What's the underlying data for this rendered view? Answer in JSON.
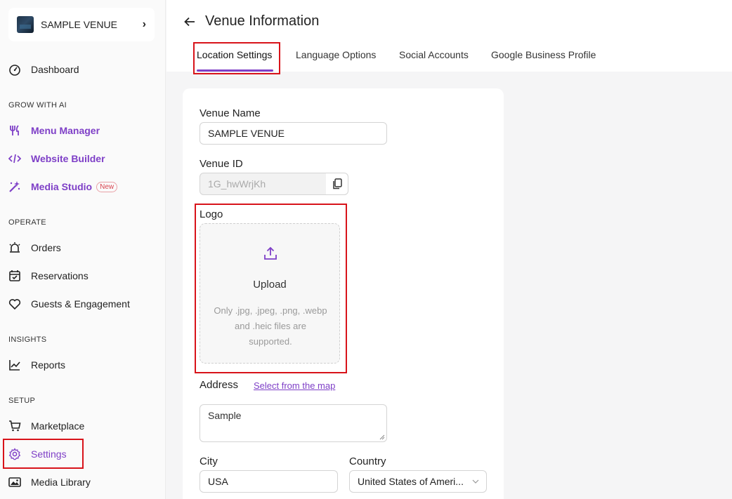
{
  "sidebar": {
    "venue_name": "SAMPLE VENUE",
    "dashboard": "Dashboard",
    "grow_section": "GROW WITH AI",
    "menu_manager": "Menu Manager",
    "website_builder": "Website Builder",
    "media_studio": "Media Studio",
    "new_badge": "New",
    "operate_section": "OPERATE",
    "orders": "Orders",
    "reservations": "Reservations",
    "guests": "Guests & Engagement",
    "insights_section": "INSIGHTS",
    "reports": "Reports",
    "setup_section": "SETUP",
    "marketplace": "Marketplace",
    "settings": "Settings",
    "media_library": "Media Library"
  },
  "header": {
    "title": "Venue Information",
    "tabs": [
      "Location Settings",
      "Language Options",
      "Social Accounts",
      "Google Business Profile"
    ]
  },
  "form": {
    "venue_name_label": "Venue Name",
    "venue_name_value": "SAMPLE VENUE",
    "venue_id_label": "Venue ID",
    "venue_id_value": "1G_hwWrjKh",
    "logo_label": "Logo",
    "upload_title": "Upload",
    "upload_hint": "Only .jpg, .jpeg, .png, .webp and .heic files are supported.",
    "address_label": "Address",
    "map_link": "Select from the map",
    "address_value": "Sample",
    "city_label": "City",
    "city_value": "USA",
    "country_label": "Country",
    "country_value": "United States of Ameri..."
  },
  "colors": {
    "accent": "#7e3fc7",
    "highlight_box": "#d8131a"
  }
}
